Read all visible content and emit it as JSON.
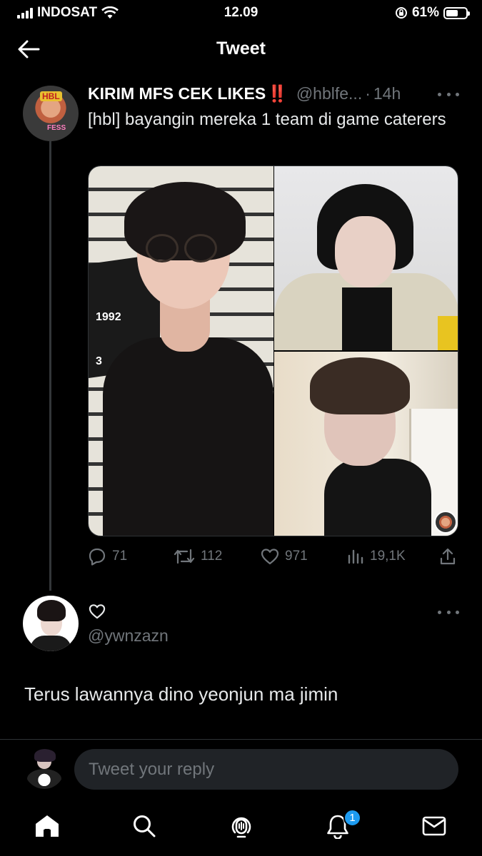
{
  "status_bar": {
    "carrier": "INDOSAT",
    "time": "12.09",
    "battery": "61%",
    "battery_level": 0.61
  },
  "header": {
    "title": "Tweet"
  },
  "tweet": {
    "author_name": "KIRIM MFS CEK LIKES",
    "author_emoji": "‼️",
    "handle": "@hblfe...",
    "separator": "·",
    "time": "14h",
    "text": "[hbl] bayangin mereka 1 team di game caterers",
    "avatar_badge": "HBL",
    "avatar_badge_2": "FESS",
    "media_caption": "1992",
    "media_caption_2": "3",
    "stats": {
      "replies": "71",
      "retweets": "112",
      "likes": "971",
      "views": "19,1K"
    }
  },
  "reply": {
    "handle": "@ywnzazn",
    "text": "Terus lawannya dino yeonjun ma jimin"
  },
  "composer": {
    "placeholder": "Tweet your reply"
  },
  "tabbar": {
    "notification_count": "1"
  },
  "colors": {
    "background": "#000000",
    "text_primary": "#e7e9ea",
    "text_secondary": "#71767b",
    "accent": "#1d9bf0",
    "divider": "#2f3336"
  }
}
